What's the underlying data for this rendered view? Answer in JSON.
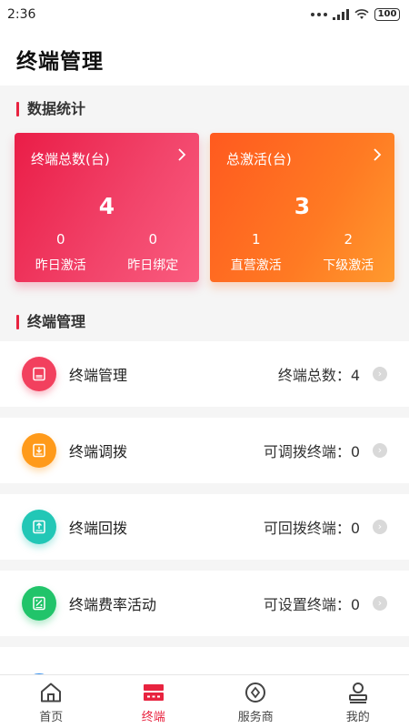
{
  "status_bar": {
    "time": "2:36",
    "battery": "100"
  },
  "header": {
    "title": "终端管理"
  },
  "stats_section": {
    "title": "数据统计"
  },
  "stats": [
    {
      "title": "终端总数(台)",
      "value": "4",
      "color": "#ea1d47",
      "subs": [
        {
          "value": "0",
          "label": "昨日激活"
        },
        {
          "value": "0",
          "label": "昨日绑定"
        }
      ]
    },
    {
      "title": "总激活(台)",
      "value": "3",
      "color": "#ff6a20",
      "subs": [
        {
          "value": "1",
          "label": "直营激活"
        },
        {
          "value": "2",
          "label": "下级激活"
        }
      ]
    }
  ],
  "manage_section": {
    "title": "终端管理"
  },
  "items": [
    {
      "label": "终端管理",
      "value": "终端总数：4",
      "icon": "terminal-icon",
      "color": "#f2405e"
    },
    {
      "label": "终端调拨",
      "value": "可调拨终端：0",
      "icon": "transfer-icon",
      "color": "#ff9a1a"
    },
    {
      "label": "终端回拨",
      "value": "可回拨终端：0",
      "icon": "return-icon",
      "color": "#22c7b6"
    },
    {
      "label": "终端费率活动",
      "value": "可设置终端：0",
      "icon": "rate-icon",
      "color": "#21c46a"
    },
    {
      "label": "",
      "value": "",
      "icon": "more-icon",
      "color": "#2d8cf0"
    }
  ],
  "tabs": [
    {
      "label": "首页",
      "icon": "home-icon",
      "active": false
    },
    {
      "label": "终端",
      "icon": "terminal-tab-icon",
      "active": true
    },
    {
      "label": "服务商",
      "icon": "provider-icon",
      "active": false
    },
    {
      "label": "我的",
      "icon": "profile-icon",
      "active": false
    }
  ],
  "colors": {
    "accent": "#e8233f",
    "tab_inactive": "#444444"
  }
}
